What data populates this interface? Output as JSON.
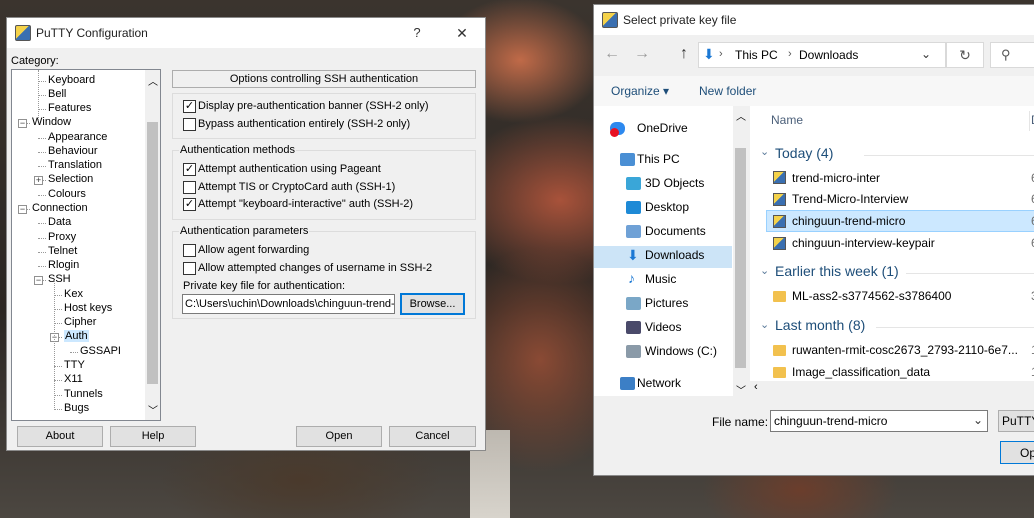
{
  "putty": {
    "title": "PuTTY Configuration",
    "help_glyph": "?",
    "close_glyph": "✕",
    "category_label": "Category:",
    "tree": [
      {
        "label": "Keyboard"
      },
      {
        "label": "Bell"
      },
      {
        "label": "Features"
      },
      {
        "label": "Window"
      },
      {
        "label": "Appearance"
      },
      {
        "label": "Behaviour"
      },
      {
        "label": "Translation"
      },
      {
        "label": "Selection"
      },
      {
        "label": "Colours"
      },
      {
        "label": "Connection"
      },
      {
        "label": "Data"
      },
      {
        "label": "Proxy"
      },
      {
        "label": "Telnet"
      },
      {
        "label": "Rlogin"
      },
      {
        "label": "SSH"
      },
      {
        "label": "Kex"
      },
      {
        "label": "Host keys"
      },
      {
        "label": "Cipher"
      },
      {
        "label": "Auth"
      },
      {
        "label": "GSSAPI"
      },
      {
        "label": "TTY"
      },
      {
        "label": "X11"
      },
      {
        "label": "Tunnels"
      },
      {
        "label": "Bugs"
      }
    ],
    "panel_header": "Options controlling SSH authentication",
    "cb1": {
      "label": "Display pre-authentication banner (SSH-2 only)",
      "checked": "✓"
    },
    "cb2": {
      "label": "Bypass authentication entirely (SSH-2 only)",
      "checked": ""
    },
    "methods_title": "Authentication methods",
    "cb3": {
      "label": "Attempt authentication using Pageant",
      "checked": "✓"
    },
    "cb4": {
      "label": "Attempt TIS or CryptoCard auth (SSH-1)",
      "checked": ""
    },
    "cb5": {
      "label": "Attempt \"keyboard-interactive\" auth (SSH-2)",
      "checked": "✓"
    },
    "params_title": "Authentication parameters",
    "cb6": {
      "label": "Allow agent forwarding",
      "checked": ""
    },
    "cb7": {
      "label": "Allow attempted changes of username in SSH-2",
      "checked": ""
    },
    "keyfile_label": "Private key file for authentication:",
    "keyfile_value": "C:\\Users\\uchin\\Downloads\\chinguun-trend-n",
    "browse": "Browse...",
    "about": "About",
    "help": "Help",
    "open": "Open",
    "cancel": "Cancel"
  },
  "filedlg": {
    "title": "Select private key file",
    "breadcrumb": [
      "This PC",
      "Downloads"
    ],
    "organize": "Organize ▾",
    "new_folder": "New folder",
    "nav": [
      "OneDrive",
      "This PC",
      "3D Objects",
      "Desktop",
      "Documents",
      "Downloads",
      "Music",
      "Pictures",
      "Videos",
      "Windows (C:)",
      "Network"
    ],
    "col_name": "Name",
    "groups": [
      {
        "title": "Today (4)",
        "files": [
          "trend-micro-inter",
          "Trend-Micro-Interview",
          "chinguun-trend-micro",
          "chinguun-interview-keypair"
        ]
      },
      {
        "title": "Earlier this week (1)",
        "files": [
          "ML-ass2-s3774562-s3786400"
        ]
      },
      {
        "title": "Last month (8)",
        "files": [
          "ruwanten-rmit-cosc2673_2793-2110-6e7...",
          "Image_classification_data"
        ]
      }
    ],
    "date_col_glyphs": [
      "6",
      "6",
      "6",
      "6",
      "3",
      "1",
      "1"
    ],
    "filename_label": "File name:",
    "filename_value": "chinguun-trend-micro",
    "filetype_value": "PuTTY",
    "open_partial": "Op"
  }
}
